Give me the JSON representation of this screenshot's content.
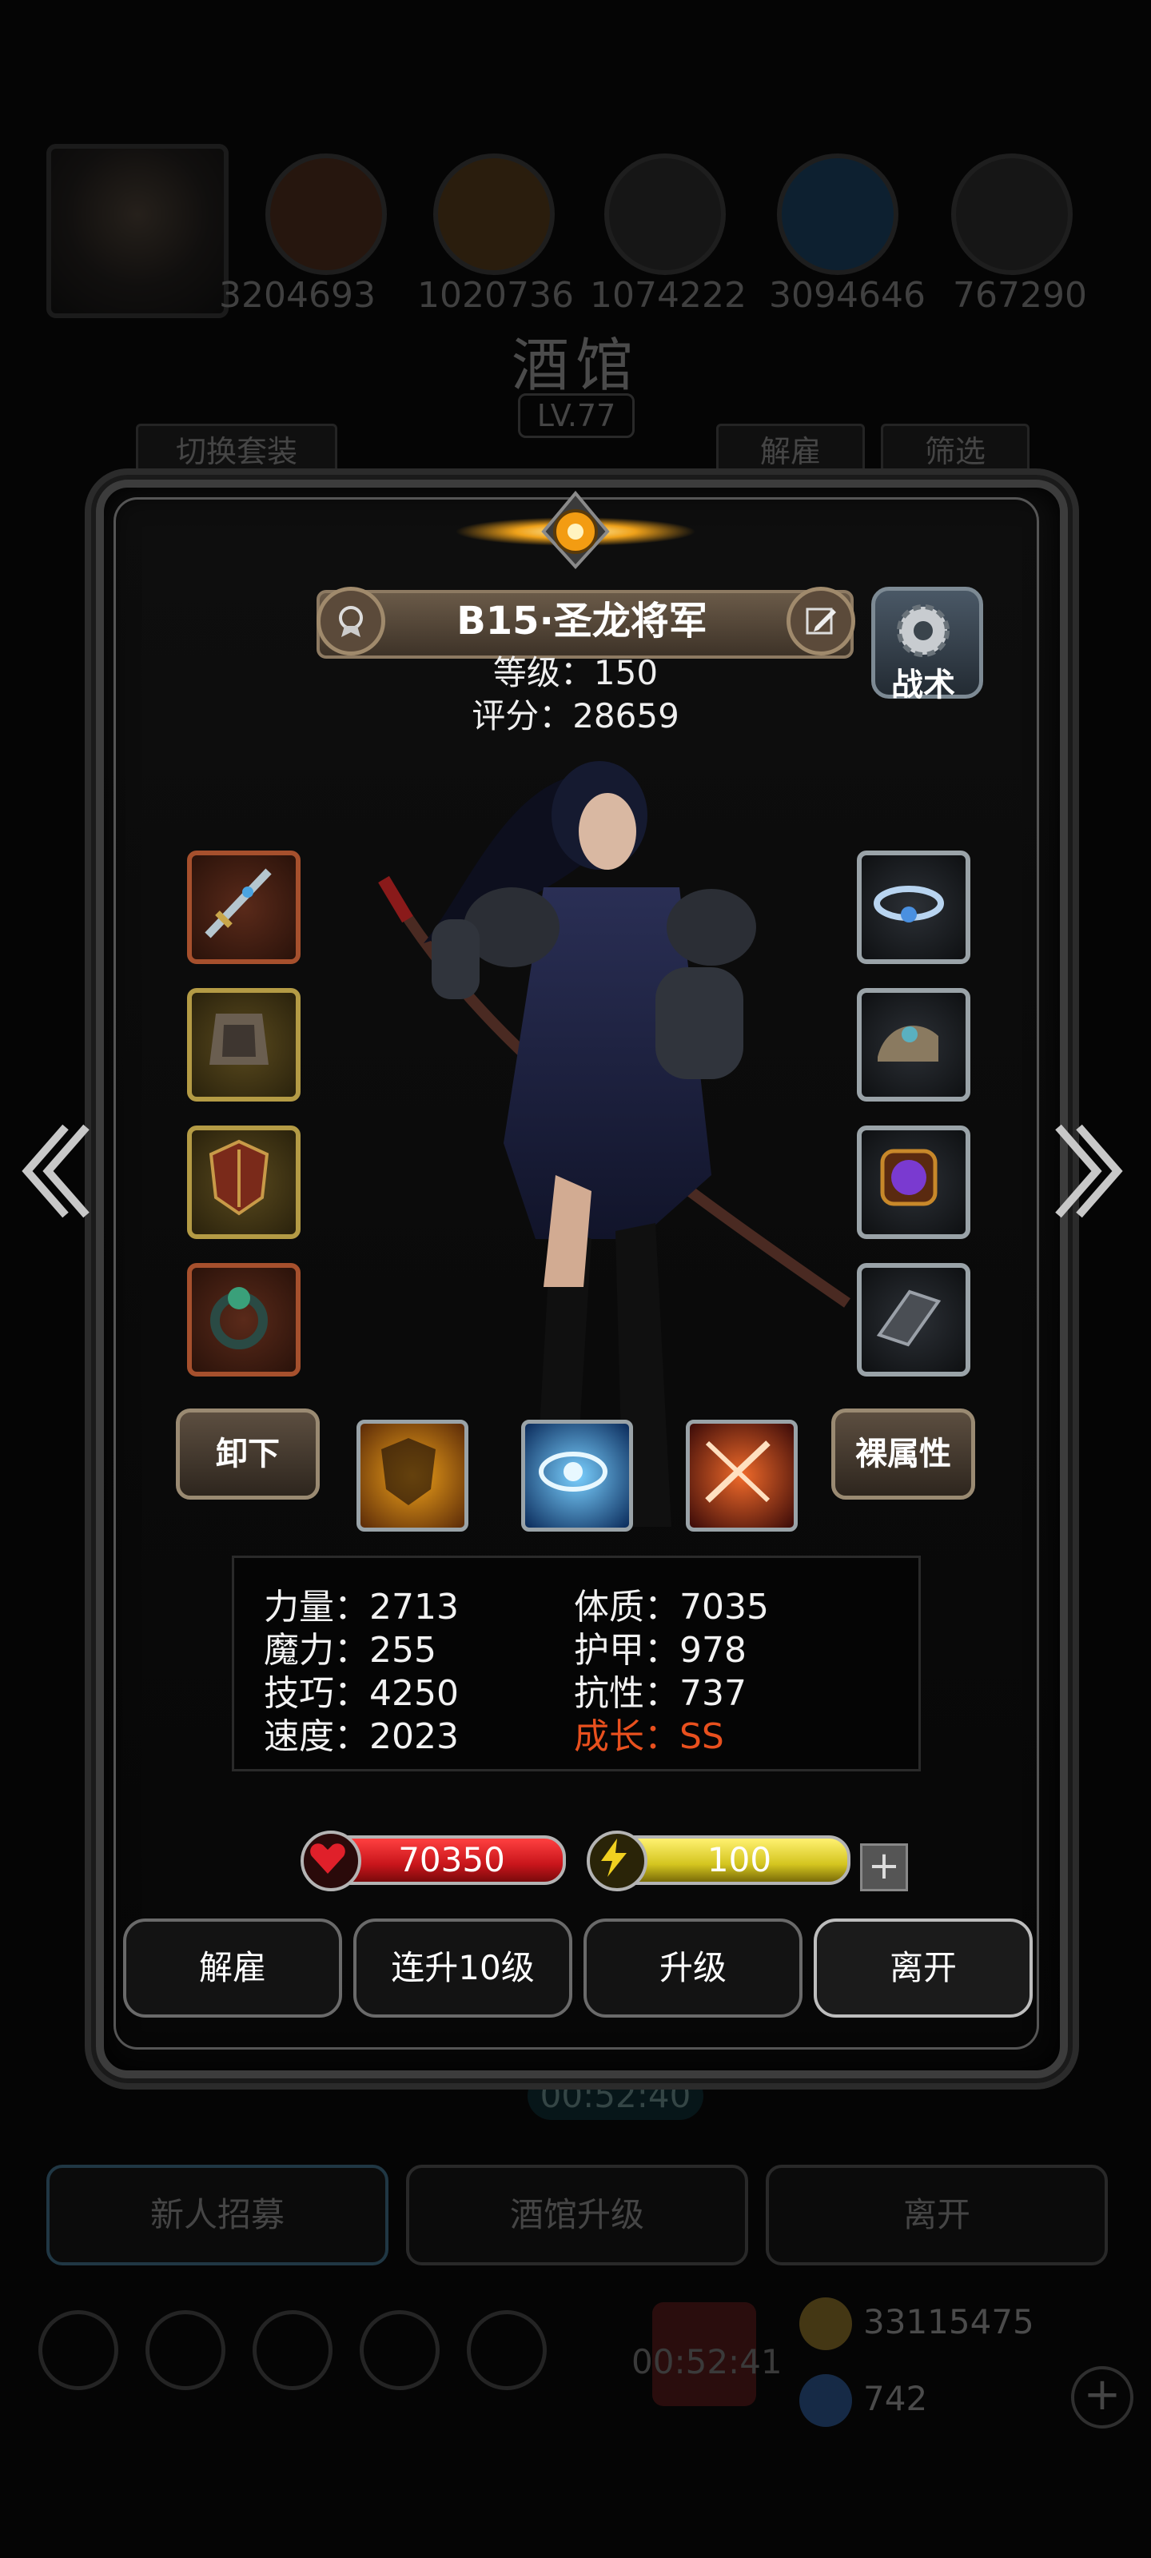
{
  "background": {
    "resource_numbers": [
      "3204693",
      "1020736",
      "1074222",
      "3094646",
      "767290"
    ],
    "title": "酒馆",
    "level": "LV.77",
    "tab_switch_outfit": "切换套装",
    "tab_dismiss": "解雇",
    "tab_filter": "筛选",
    "timer_top": "00:52:40",
    "timer_bottom": "00:52:41",
    "btn_recruit": "新人招募",
    "btn_upgrade_tavern": "酒馆升级",
    "btn_leave": "离开",
    "gold": "33115475",
    "gems": "742"
  },
  "hero": {
    "name": "B15·圣龙将军",
    "level_line": "等级：150",
    "score_line": "评分：28659",
    "tactics_label": "战术"
  },
  "actions": {
    "unequip": "卸下",
    "naked_attributes": "裸属性"
  },
  "stats": {
    "strength": "力量：2713",
    "magic": "魔力：255",
    "skill": "技巧：4250",
    "speed": "速度：2023",
    "constitution": "体质：7035",
    "armor": "护甲：978",
    "resistance": "抗性：737",
    "growth": "成长：SS"
  },
  "bars": {
    "hp": "70350",
    "energy": "100"
  },
  "buttons": {
    "dismiss": "解雇",
    "level_up_10": "连升10级",
    "level_up": "升级",
    "leave": "离开"
  },
  "colors": {
    "hp_bar": "#c8151b",
    "energy_bar": "#d4c51f",
    "growth_text": "#e8501e"
  }
}
